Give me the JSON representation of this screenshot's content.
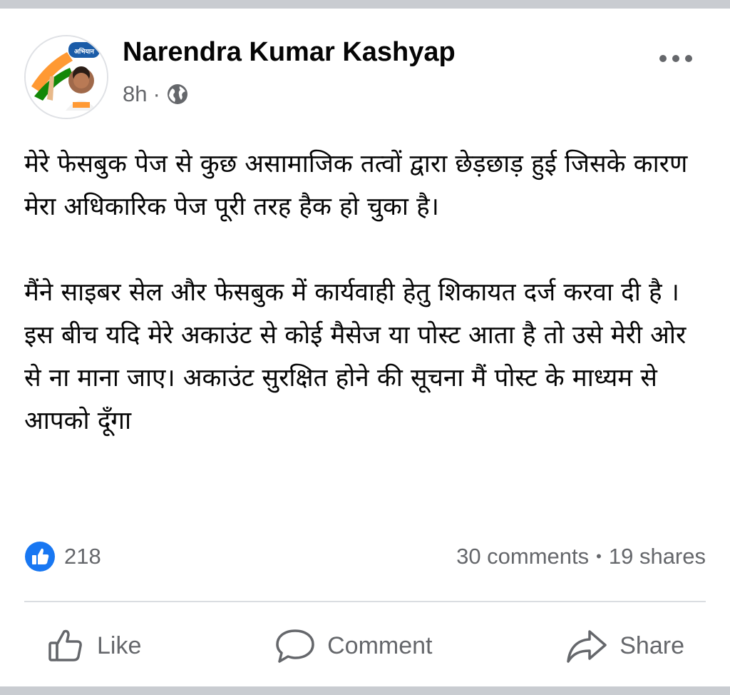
{
  "post": {
    "author_name": "Narendra Kumar Kashyap",
    "timestamp": "8h",
    "meta_separator": "·",
    "privacy_icon": "globe-icon",
    "more_icon": "more-options-icon",
    "avatar_banner_text": "अभियान",
    "body_paragraphs": [
      "मेरे फेसबुक पेज से कुछ असामाजिक तत्वों द्वारा छेड़छाड़ हुई जिसके कारण मेरा अधिकारिक पेज पूरी तरह हैक हो चुका है।",
      "मैंने साइबर सेल और फेसबुक में कार्यवाही हेतु शिकायत दर्ज करवा दी है । इस बीच यदि मेरे अकाउंट से कोई मैसेज या पोस्ट आता है तो उसे मेरी ओर से ना माना जाए। अकाउंट सुरक्षित होने की सूचना मैं पोस्ट के माध्यम से आपको दूँगा"
    ]
  },
  "stats": {
    "reaction_icon": "like-reaction-icon",
    "reaction_count": "218",
    "comments": "30 comments",
    "separator": "•",
    "shares": "19 shares"
  },
  "actions": {
    "like_label": "Like",
    "comment_label": "Comment",
    "share_label": "Share"
  },
  "colors": {
    "text_primary": "#050505",
    "text_secondary": "#65676b",
    "accent_blue": "#1877f2",
    "divider": "#dadde1",
    "frame_gray": "#c9ccd1"
  }
}
